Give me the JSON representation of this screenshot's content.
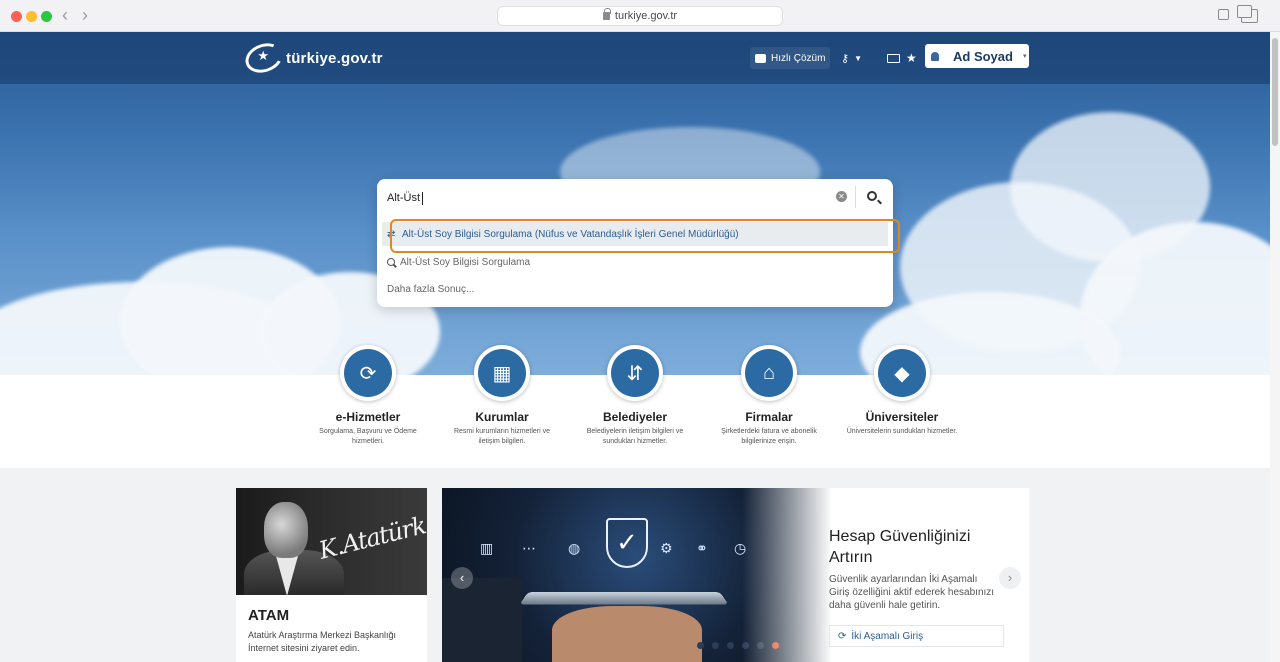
{
  "browser": {
    "url": "turkiye.gov.tr"
  },
  "header": {
    "logo_text": "türkiye.gov.tr",
    "quick_solution_label": "Hızlı Çözüm",
    "user_name": "Ad Soyad"
  },
  "search": {
    "value": "Alt-Üst",
    "suggestions": [
      {
        "label": "Alt-Üst Soy Bilgisi Sorgulama (Nüfus ve Vatandaşlık İşleri Genel Müdürlüğü)",
        "icon": "service-arrow-icon",
        "highlighted": true
      },
      {
        "label": "Alt-Üst Soy Bilgisi Sorgulama",
        "icon": "search-icon"
      },
      {
        "label": "Daha fazla Sonuç..."
      }
    ]
  },
  "categories": [
    {
      "title": "e-Hizmetler",
      "desc": "Sorgulama, Başvuru ve Ödeme hizmetleri.",
      "icon": "refresh-icon"
    },
    {
      "title": "Kurumlar",
      "desc": "Resmi kurumların hizmetleri ve iletişim bilgileri.",
      "icon": "building-icon"
    },
    {
      "title": "Belediyeler",
      "desc": "Belediyelerin iletişim bilgileri ve sundukları hizmetler.",
      "icon": "signpost-icon"
    },
    {
      "title": "Firmalar",
      "desc": "Şirketlerdeki fatura ve abonelik bilgilerinize erişin.",
      "icon": "factory-icon"
    },
    {
      "title": "Üniversiteler",
      "desc": "Üniversitelerin sundukları hizmetler.",
      "icon": "graduation-cap-icon"
    }
  ],
  "atam": {
    "title": "ATAM",
    "desc": "Atatürk Araştırma Merkezi Başkanlığı İnternet sitesini ziyaret edin."
  },
  "slider": {
    "title": "Hesap Güvenliğinizi Artırın",
    "desc": "Güvenlik ayarlarından İki Aşamalı Giriş özelliğini aktif ederek hesabınızı daha güvenli hale getirin.",
    "link_label": "İki Aşamalı Giriş",
    "active_dot": 5,
    "dot_count": 6
  },
  "colors": {
    "accent": "#2c6aa4",
    "highlight": "#e0881e",
    "active_dot": "#e0451f"
  }
}
